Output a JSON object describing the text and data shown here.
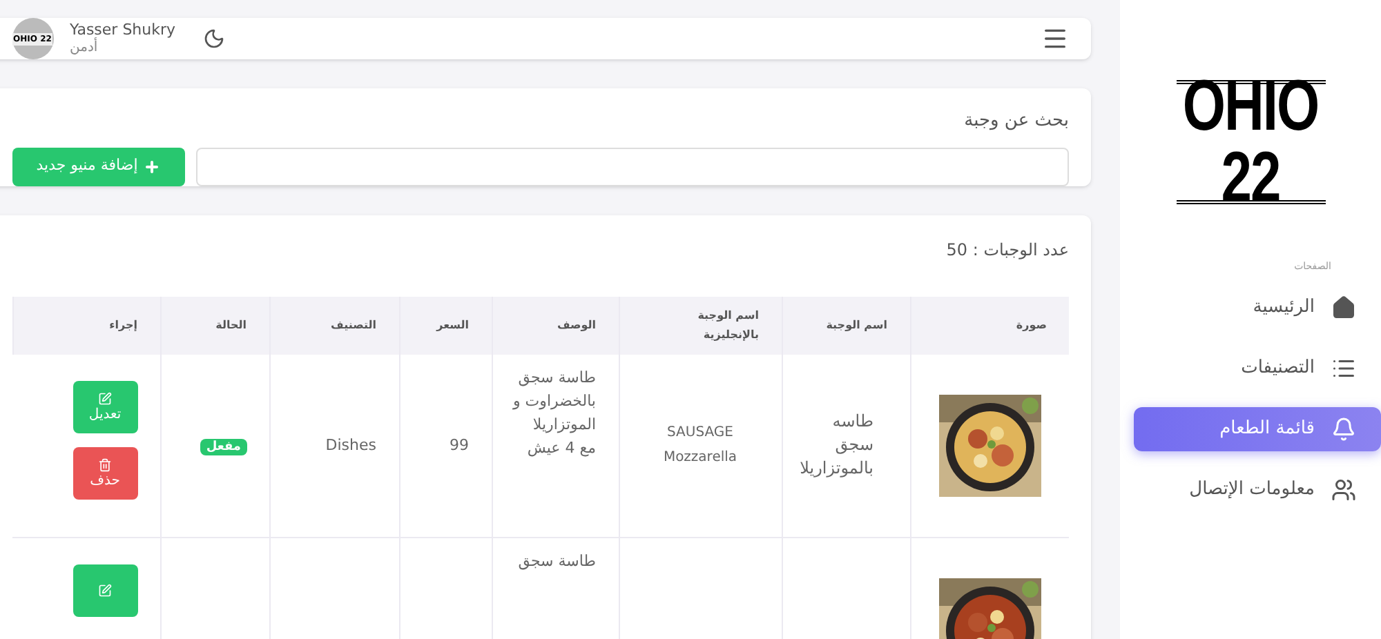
{
  "sidebar": {
    "logo": "OHIO 22",
    "section_label": "الصفحات",
    "items": [
      {
        "kind": "home",
        "label": "الرئيسية",
        "selected": false
      },
      {
        "kind": "list",
        "label": "التصنيفات",
        "selected": false
      },
      {
        "kind": "bell",
        "label": "قائمة الطعام",
        "selected": true
      },
      {
        "kind": "users",
        "label": "معلومات الإتصال",
        "selected": false
      }
    ]
  },
  "header": {
    "user_name": "Yasser Shukry",
    "role": "أدمن",
    "avatar_text": "OHIO 22"
  },
  "search": {
    "title": "بحث عن وجبة",
    "add_button": "إضافة منيو جديد"
  },
  "table": {
    "count_label": "عدد الوجبات : 50",
    "columns": [
      "صورة",
      "اسم الوجبة",
      "اسم الوجبة بالإنجليزية",
      "الوصف",
      "السعر",
      "التصنيف",
      "الحالة",
      "إجراء"
    ],
    "rows": [
      {
        "name": "طاسه سجق بالموتزاريلا",
        "name_en": "SAUSAGE Mozzarella",
        "description": "طاسة سجق بالخضراوت و الموتزاريلا مع 4 عيش",
        "price": "99",
        "category": "Dishes",
        "status": {
          "label": "مفعل",
          "active": true
        },
        "actions": [
          {
            "kind": "edit",
            "label": "تعديل"
          },
          {
            "kind": "delete",
            "label": "حذف"
          }
        ]
      },
      {
        "description": "طاسة سجق",
        "actions": [
          {
            "kind": "edit"
          }
        ]
      }
    ]
  }
}
